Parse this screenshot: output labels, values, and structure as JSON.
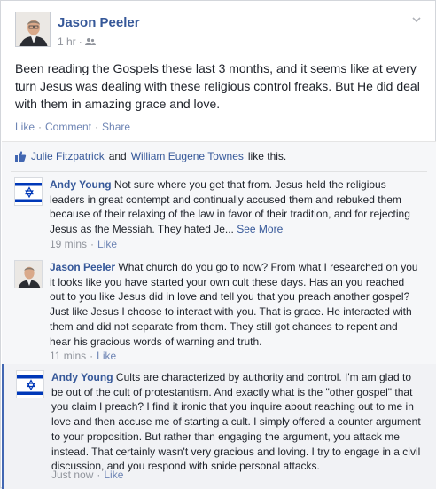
{
  "post": {
    "author": "Jason Peeler",
    "time": "1 hr",
    "separator": "·",
    "privacy_icon": "friends-icon",
    "body": "Been reading the Gospels these last 3 months, and it seems like at every turn Jesus was dealing with these religious control freaks. But He did deal with them in amazing grace and love.",
    "actions": {
      "like": "Like",
      "comment": "Comment",
      "share": "Share",
      "dot": "·"
    }
  },
  "likes": {
    "icon": "thumbs-up-icon",
    "name1": "Julie Fitzpatrick",
    "and": "and",
    "name2": "William Eugene Townes",
    "suffix": "like this."
  },
  "comments": [
    {
      "author": "Andy Young",
      "avatar": "israel-flag-icon",
      "text": "Not sure where you get that from. Jesus held the religious leaders in great contempt and continually accused them and rebuked them because of their relaxing of the law in favor of their tradition, and for rejecting Jesus as the Messiah. They hated Je...",
      "see_more": "See More",
      "time": "19 mins",
      "like": "Like"
    },
    {
      "author": "Jason Peeler",
      "avatar": "user-photo-icon",
      "text": "What church do you go to now? From what I researched on you it looks like you have started your own cult these days. Has an you reached out to you like Jesus did in love and tell you that you preach another gospel? Just like Jesus I choose to interact with you. That is grace. He interacted with them and did not separate from them. They still got chances to repent and hear his gracious words of warning and truth.",
      "time": "11 mins",
      "like": "Like"
    },
    {
      "author": "Andy Young",
      "avatar": "israel-flag-icon",
      "text": "Cults are characterized by authority and control. I'm am glad to be out of the cult of protestantism. And exactly what is the \"other gospel\" that you claim I preach? I find it ironic that you inquire about reaching out to me in love and then accuse me of starting a cult. I simply offered a counter argument to your proposition. But rather than engaging the argument, you attack me instead. That certainly wasn't very gracious and loving. I try to engage in a civil discussion, and you respond with snide personal attacks.",
      "time": "Just now",
      "like": "Like"
    }
  ],
  "colors": {
    "link": "#365899",
    "action": "#6d84b4",
    "meta": "#90949c",
    "flag_blue": "#0038b8"
  }
}
